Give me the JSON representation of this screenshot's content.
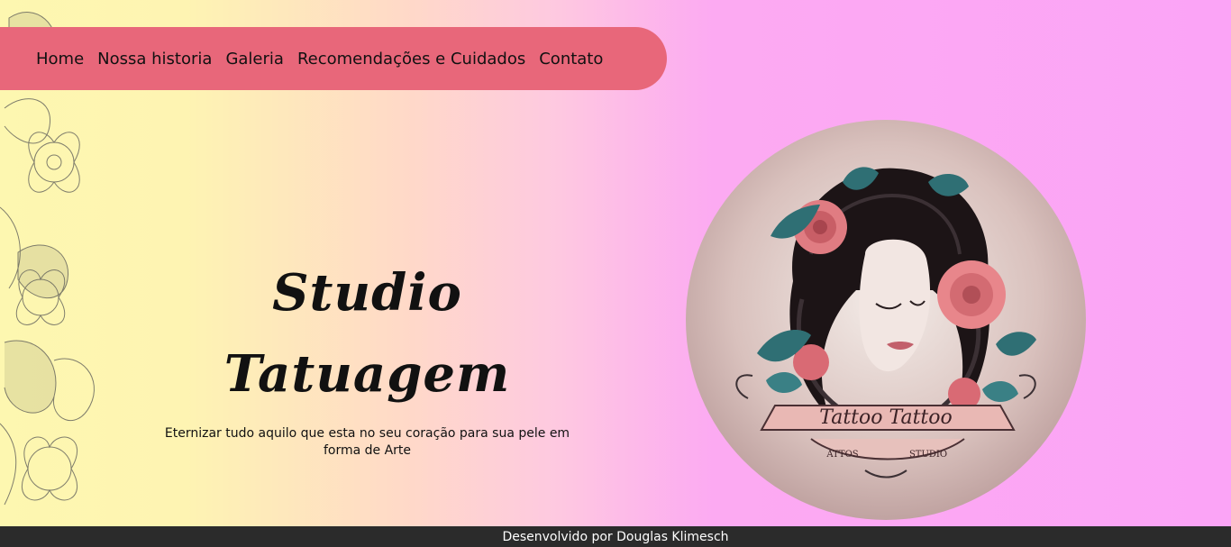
{
  "nav": {
    "items": [
      {
        "label": "Home"
      },
      {
        "label": "Nossa historia"
      },
      {
        "label": "Galeria"
      },
      {
        "label": "Recomendações e Cuidados"
      },
      {
        "label": "Contato"
      }
    ]
  },
  "hero": {
    "title": "Studio Tatuagem",
    "subtitle": "Eternizar tudo aquilo que esta no seu coração para sua pele em forma de Arte"
  },
  "logo": {
    "banner_text": "Tattoo Tattoo",
    "lower_text_left": "ATTOS",
    "lower_text_right": "STUDIO"
  },
  "footer": {
    "text": "Desenvolvido por Douglas Klimesch"
  },
  "colors": {
    "nav_background": "#e8677a",
    "footer_background": "#2b2b2b",
    "gradient_left": "#fdf7b0",
    "gradient_right": "#fba4f6"
  }
}
